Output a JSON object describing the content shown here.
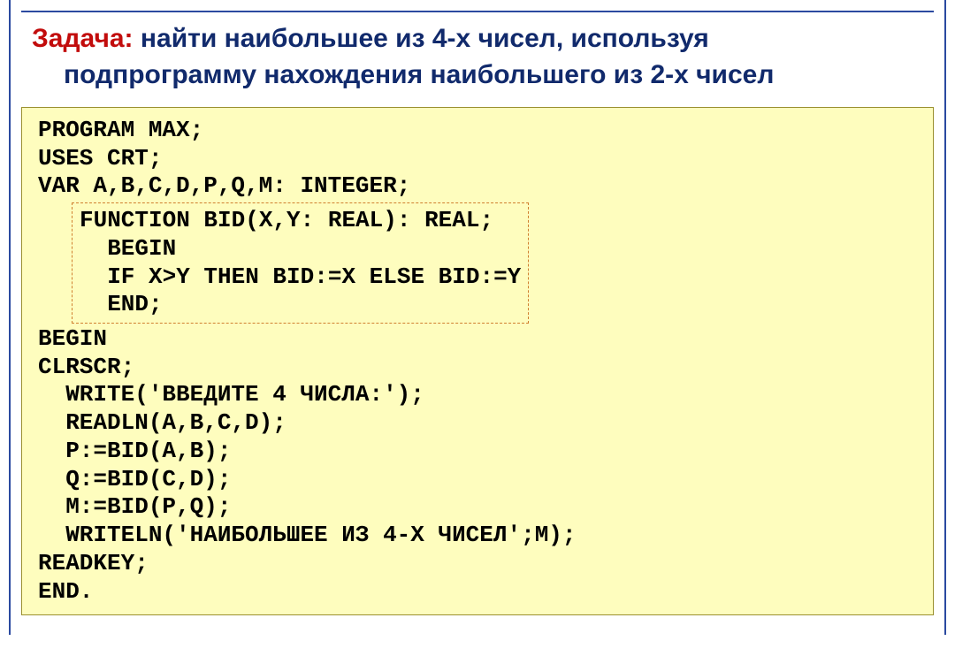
{
  "task": {
    "label": "Задача:",
    "line1": " найти наибольшее из 4-х чисел, используя",
    "line2": "подпрограмму нахождения наибольшего из 2-х чисел"
  },
  "code": {
    "l1": "PROGRAM MAX;",
    "l2": "USES CRT;",
    "l3": "VAR A,B,C,D,P,Q,M: INTEGER;",
    "func": {
      "f1": "FUNCTION BID(X,Y: REAL): REAL;",
      "f2": "  BEGIN",
      "f3": "  IF X>Y THEN BID:=X ELSE BID:=Y",
      "f4": "  END;"
    },
    "l4": "BEGIN",
    "l5": "CLRSCR;",
    "l6": "  WRITE('ВВЕДИТЕ 4 ЧИСЛА:');",
    "l7": "  READLN(A,B,C,D);",
    "l8": "  P:=BID(A,B);",
    "l9": "  Q:=BID(C,D);",
    "l10": "  M:=BID(P,Q);",
    "l11": "  WRITELN('НАИБОЛЬШЕЕ ИЗ 4-Х ЧИСЕЛ';M);",
    "l12": "READKEY;",
    "l13": "END."
  }
}
